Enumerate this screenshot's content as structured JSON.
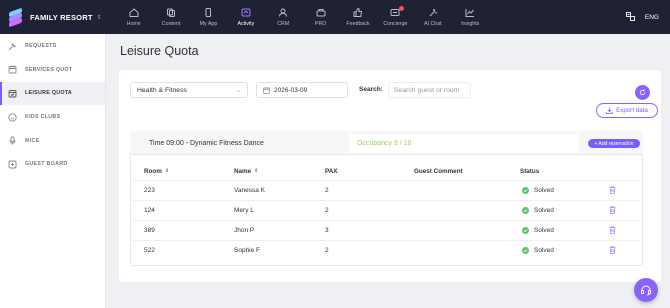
{
  "brand": {
    "name": "FAMILY RESORT"
  },
  "nav": [
    {
      "label": "Home",
      "icon": "home-icon"
    },
    {
      "label": "Content",
      "icon": "content-icon"
    },
    {
      "label": "My App",
      "icon": "phone-icon"
    },
    {
      "label": "Activity",
      "icon": "activity-icon",
      "active": true
    },
    {
      "label": "CRM",
      "icon": "people-icon"
    },
    {
      "label": "PRO",
      "icon": "pro-icon"
    },
    {
      "label": "Feedback",
      "icon": "thumbs-up-icon"
    },
    {
      "label": "Concierge",
      "icon": "concierge-icon",
      "badge": true
    },
    {
      "label": "AI Chat",
      "icon": "sparkle-icon"
    },
    {
      "label": "Insights",
      "icon": "chart-icon"
    }
  ],
  "top_right": {
    "language": "ENG"
  },
  "sidebar": {
    "items": [
      {
        "label": "REQUESTS",
        "icon": "wrench-icon"
      },
      {
        "label": "SERVICES QUOT",
        "icon": "calendar-icon"
      },
      {
        "label": "LEISURE QUOTA",
        "icon": "calendar-check-icon",
        "active": true
      },
      {
        "label": "KIDS CLUBS",
        "icon": "smile-icon"
      },
      {
        "label": "MICE",
        "icon": "microphone-icon"
      },
      {
        "label": "GUEST BOARD",
        "icon": "board-icon"
      }
    ]
  },
  "page": {
    "title": "Leisure Quota"
  },
  "filters": {
    "category": "Health & Fitness",
    "date": "2026-03-09",
    "search_label": "Search:",
    "search_placeholder": "Search guest or room",
    "export_label": "Export data"
  },
  "session": {
    "title": "Time 09:00 - Dynamic Fitness Dance",
    "occupancy": "Occupancy 9 / 10",
    "add_label": "+ Add reservation"
  },
  "table": {
    "headers": {
      "room": "Room",
      "name": "Name",
      "pax": "PAX",
      "comment": "Guest Comment",
      "status": "Status"
    },
    "rows": [
      {
        "room": "223",
        "name": "Vanessa K",
        "pax": "2",
        "comment": "",
        "status": "Solved"
      },
      {
        "room": "124",
        "name": "Mery L",
        "pax": "2",
        "comment": "",
        "status": "Solved"
      },
      {
        "room": "389",
        "name": "Jhon P",
        "pax": "3",
        "comment": "",
        "status": "Solved"
      },
      {
        "room": "522",
        "name": "Sophie F",
        "pax": "2",
        "comment": "",
        "status": "Solved"
      }
    ]
  },
  "colors": {
    "accent": "#7b5cff",
    "topbar": "#1f2235",
    "occupancy": "#9fd15a",
    "solved": "#5cc26a"
  }
}
